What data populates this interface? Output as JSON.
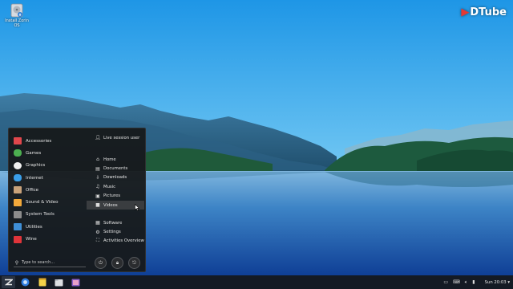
{
  "desktop": {
    "icons": [
      {
        "label": "Install Zorin OS",
        "icon": "disk-installer-icon"
      }
    ],
    "watermark": "DTube"
  },
  "menu": {
    "categories": [
      {
        "label": "Accessories",
        "icon": "accessories-icon",
        "color": "#e0474c"
      },
      {
        "label": "Games",
        "icon": "games-icon",
        "color": "#4caf50"
      },
      {
        "label": "Graphics",
        "icon": "graphics-palette-icon",
        "color": "#f0f0f0"
      },
      {
        "label": "Internet",
        "icon": "internet-cloud-icon",
        "color": "#3a9ee8"
      },
      {
        "label": "Office",
        "icon": "office-icon",
        "color": "#c8a27a"
      },
      {
        "label": "Sound & Video",
        "icon": "sound-video-icon",
        "color": "#f2a93b"
      },
      {
        "label": "System Tools",
        "icon": "system-tools-icon",
        "color": "#8c8c8c"
      },
      {
        "label": "Utilities",
        "icon": "utilities-icon",
        "color": "#3f8fd6"
      },
      {
        "label": "Wine",
        "icon": "wine-icon",
        "color": "#e0343a"
      }
    ],
    "user": {
      "label": "Live session user",
      "icon": "user-icon"
    },
    "places": [
      {
        "label": "Home",
        "icon": "home-icon",
        "glyph": "⌂"
      },
      {
        "label": "Documents",
        "icon": "documents-icon",
        "glyph": "▤"
      },
      {
        "label": "Downloads",
        "icon": "downloads-icon",
        "glyph": "⇩"
      },
      {
        "label": "Music",
        "icon": "music-icon",
        "glyph": "♫"
      },
      {
        "label": "Pictures",
        "icon": "pictures-icon",
        "glyph": "▣"
      },
      {
        "label": "Videos",
        "icon": "videos-icon",
        "glyph": "■"
      }
    ],
    "system": [
      {
        "label": "Software",
        "icon": "software-icon",
        "glyph": "▦"
      },
      {
        "label": "Settings",
        "icon": "settings-gear-icon",
        "glyph": "⚙"
      },
      {
        "label": "Activities Overview",
        "icon": "activities-overview-icon",
        "glyph": "⛶"
      }
    ],
    "search_placeholder": "Type to search...",
    "power_buttons": [
      {
        "icon": "power-icon",
        "glyph": "⏻"
      },
      {
        "icon": "lock-icon",
        "glyph": "🔒︎"
      },
      {
        "icon": "logout-icon",
        "glyph": "⎋"
      }
    ]
  },
  "taskbar": {
    "apps": [
      {
        "icon": "zorin-menu-icon"
      },
      {
        "icon": "web-browser-icon"
      },
      {
        "icon": "notes-icon"
      },
      {
        "icon": "files-icon"
      },
      {
        "icon": "software-store-icon"
      }
    ],
    "tray": [
      {
        "icon": "screen-record-icon",
        "glyph": "▭"
      },
      {
        "icon": "keyboard-layout-icon",
        "glyph": "⌨"
      },
      {
        "icon": "volume-icon",
        "glyph": "🔈︎"
      },
      {
        "icon": "battery-icon",
        "glyph": "▮"
      }
    ],
    "clock": "Sun 20:03",
    "notification_glyph": "▾"
  },
  "colors": {
    "taskbar": "#141a24",
    "menu_bg": "#16181a",
    "sky_top": "#1f97e6",
    "lake": "#1a5ea8"
  }
}
